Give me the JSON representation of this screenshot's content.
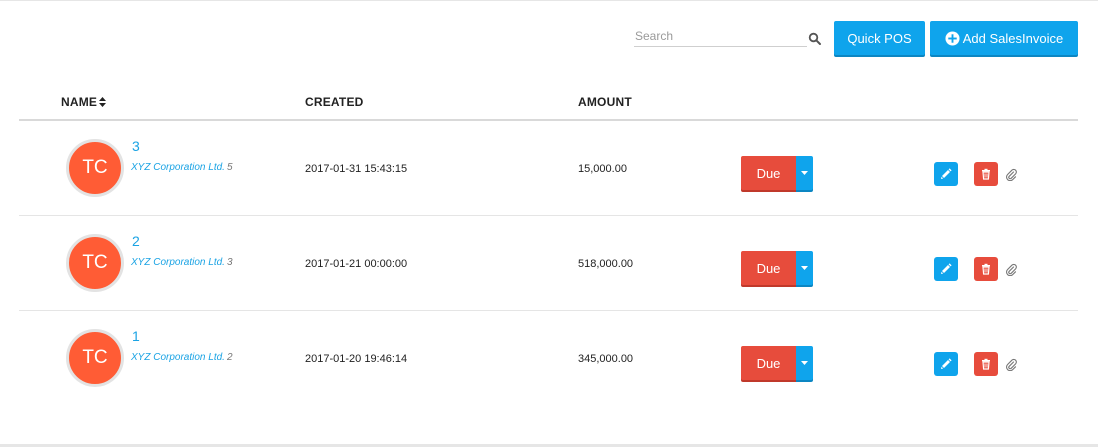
{
  "search": {
    "placeholder": "Search",
    "value": ""
  },
  "toolbar": {
    "quick_pos_label": "Quick POS",
    "add_label": "Add SalesInvoice"
  },
  "table": {
    "headers": {
      "name": "NAME",
      "created": "CREATED",
      "amount": "AMOUNT"
    },
    "rows": [
      {
        "avatar": "TC",
        "number": "3",
        "company": "XYZ Corporation Ltd.",
        "company_count": "5",
        "created": "2017-01-31 15:43:15",
        "amount": "15,000.00",
        "status": "Due"
      },
      {
        "avatar": "TC",
        "number": "2",
        "company": "XYZ Corporation Ltd.",
        "company_count": "3",
        "created": "2017-01-21 00:00:00",
        "amount": "518,000.00",
        "status": "Due"
      },
      {
        "avatar": "TC",
        "number": "1",
        "company": "XYZ Corporation Ltd.",
        "company_count": "2",
        "created": "2017-01-20 19:46:14",
        "amount": "345,000.00",
        "status": "Due"
      }
    ]
  },
  "colors": {
    "accent_blue": "#0fa4ec",
    "danger_red": "#e74c3c",
    "avatar_orange": "#ff5c35",
    "link_blue": "#1aa3e4"
  },
  "icons": {
    "search": "search-icon",
    "add": "plus-circle-icon",
    "sort": "sort-icon",
    "edit": "pencil-icon",
    "delete": "trash-icon",
    "attach": "paperclip-icon",
    "dropdown": "caret-down-icon"
  }
}
